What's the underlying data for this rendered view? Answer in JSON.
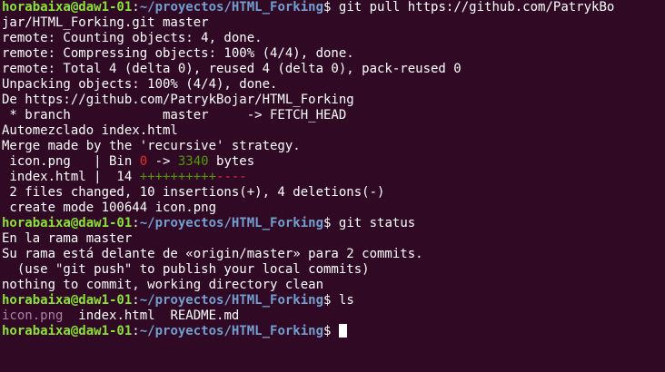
{
  "prompt": {
    "user_host": "horabaixa@daw1-01",
    "sep": ":",
    "path": "~/proyectos/HTML_Forking",
    "symbol": "$ "
  },
  "cmd_pull_1": "git pull https://github.com/PatrykBo",
  "cmd_pull_2": "jar/HTML_Forking.git master",
  "out": {
    "l1": "remote: Counting objects: 4, done.",
    "l2": "remote: Compressing objects: 100% (4/4), done.",
    "l3": "remote: Total 4 (delta 0), reused 4 (delta 0), pack-reused 0",
    "l4": "Unpacking objects: 100% (4/4), done.",
    "l5": "De https://github.com/PatrykBojar/HTML_Forking",
    "l6": " * branch            master     -> FETCH_HEAD",
    "l7": "Automezclado index.html",
    "l8": "Merge made by the 'recursive' strategy."
  },
  "stat_icon": {
    "pre": " icon.png   | Bin ",
    "old": "0",
    "mid": " -> ",
    "new": "3340",
    "post": " bytes"
  },
  "stat_index": {
    "pre": " index.html |  14 ",
    "plus": "++++++++++",
    "minus": "----"
  },
  "summary": " 2 files changed, 10 insertions(+), 4 deletions(-)",
  "create": " create mode 100644 icon.png",
  "cmd_status": "git status",
  "status": {
    "l1": "En la rama master",
    "l2": "Su rama está delante de «origin/master» para 2 commits.",
    "l3": "  (use \"git push\" to publish your local commits)",
    "l4": "nothing to commit, working directory clean"
  },
  "cmd_ls": "ls",
  "ls": {
    "icon": "icon.png",
    "gap1": "  ",
    "index": "index.html",
    "gap2": "  ",
    "readme": "README.md"
  },
  "colors": {
    "background": "#300a24",
    "user_host": "#8ae234",
    "path": "#729fcf",
    "text": "#ffffff",
    "diff_add": "#4e9a06",
    "diff_del": "#ef2929",
    "image_file": "#ad7fa8"
  }
}
